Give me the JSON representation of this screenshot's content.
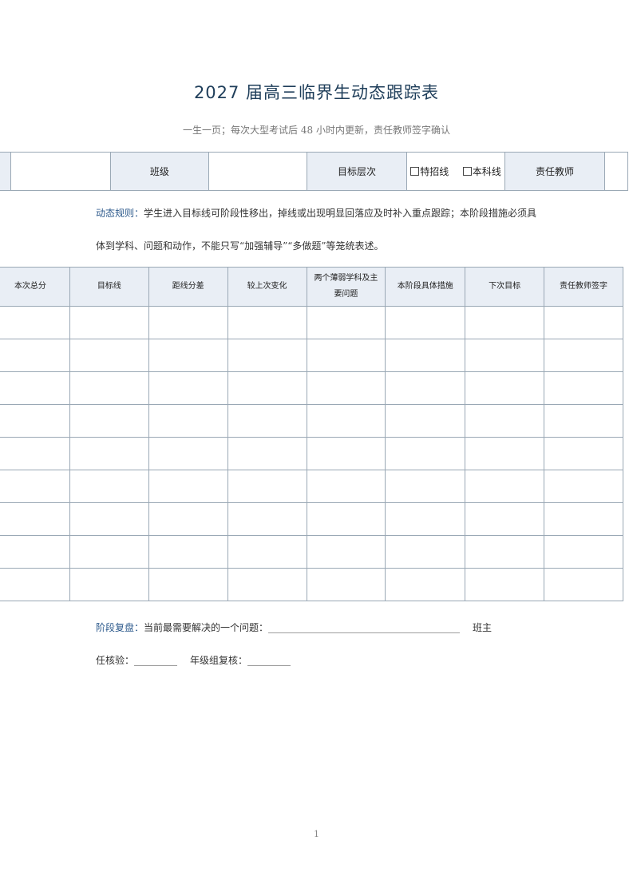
{
  "header": {
    "title": "2027 届高三临界生动态跟踪表",
    "subtitle": "一生一页；每次大型考试后 48 小时内更新，责任教师签字确认"
  },
  "info": {
    "class_label": "班级",
    "target_level_label": "目标层次",
    "option_special": "特招线",
    "option_undergrad": "本科线",
    "teacher_label": "责任教师"
  },
  "rules": {
    "label": "动态规则：",
    "line1": "学生进入目标线可阶段性移出，掉线或出现明显回落应及时补入重点跟踪；本阶段措施必须具",
    "line2": "体到学科、问题和动作，不能只写“加强辅导”“多做题”等笼统表述。"
  },
  "table": {
    "headers": [
      "本次总分",
      "目标线",
      "距线分差",
      "较上次变化",
      "两个薄弱学科及主要问题",
      "本阶段具体措施",
      "下次目标",
      "责任教师签字"
    ],
    "row_count": 9
  },
  "review": {
    "label": "阶段复盘：",
    "question_text": "当前最需要解决的一个问题：",
    "question_blank": "________________________________________",
    "head_teacher_suffix": "班主",
    "head_teacher_prefix": "任核验：",
    "head_teacher_blank": "_________",
    "grade_label": "年级组复核：",
    "grade_blank": "_________"
  },
  "footer": {
    "page_number": "1"
  }
}
